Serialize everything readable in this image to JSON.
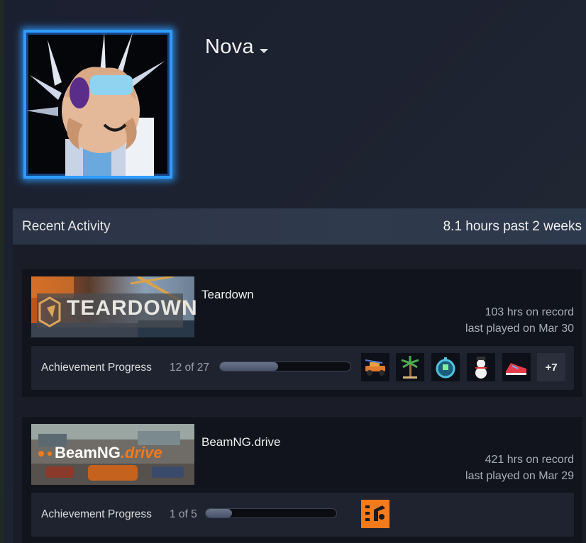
{
  "profile": {
    "username": "Nova"
  },
  "recent_activity": {
    "title": "Recent Activity",
    "hours_summary": "8.1 hours past 2 weeks"
  },
  "games": [
    {
      "name": "Teardown",
      "capsule_text": "TEARDOWN",
      "hours": "103 hrs on record",
      "last_played": "last played on Mar 30",
      "achievement_label": "Achievement Progress",
      "achievement_count": "12 of 27",
      "achievement_progress": 0.444,
      "achievement_icons": [
        "car-achievement-icon",
        "palm-tree-achievement-icon",
        "stopwatch-achievement-icon",
        "snowman-achievement-icon",
        "sneaker-achievement-icon"
      ],
      "more_achievements": "+7"
    },
    {
      "name": "BeamNG.drive",
      "capsule_text_1": "BeamNG",
      "capsule_text_2": ".drive",
      "hours": "421 hrs on record",
      "last_played": "last played on Mar 29",
      "achievement_label": "Achievement Progress",
      "achievement_count": "1 of 5",
      "achievement_progress": 0.2,
      "achievement_icons": [
        "beamng-achievement-icon"
      ]
    }
  ],
  "colors": {
    "avatar_glow": "#2f9cff",
    "panel_bg": "#1a1d28",
    "card_bg": "#11141c",
    "accent_orange": "#f47a1c"
  }
}
